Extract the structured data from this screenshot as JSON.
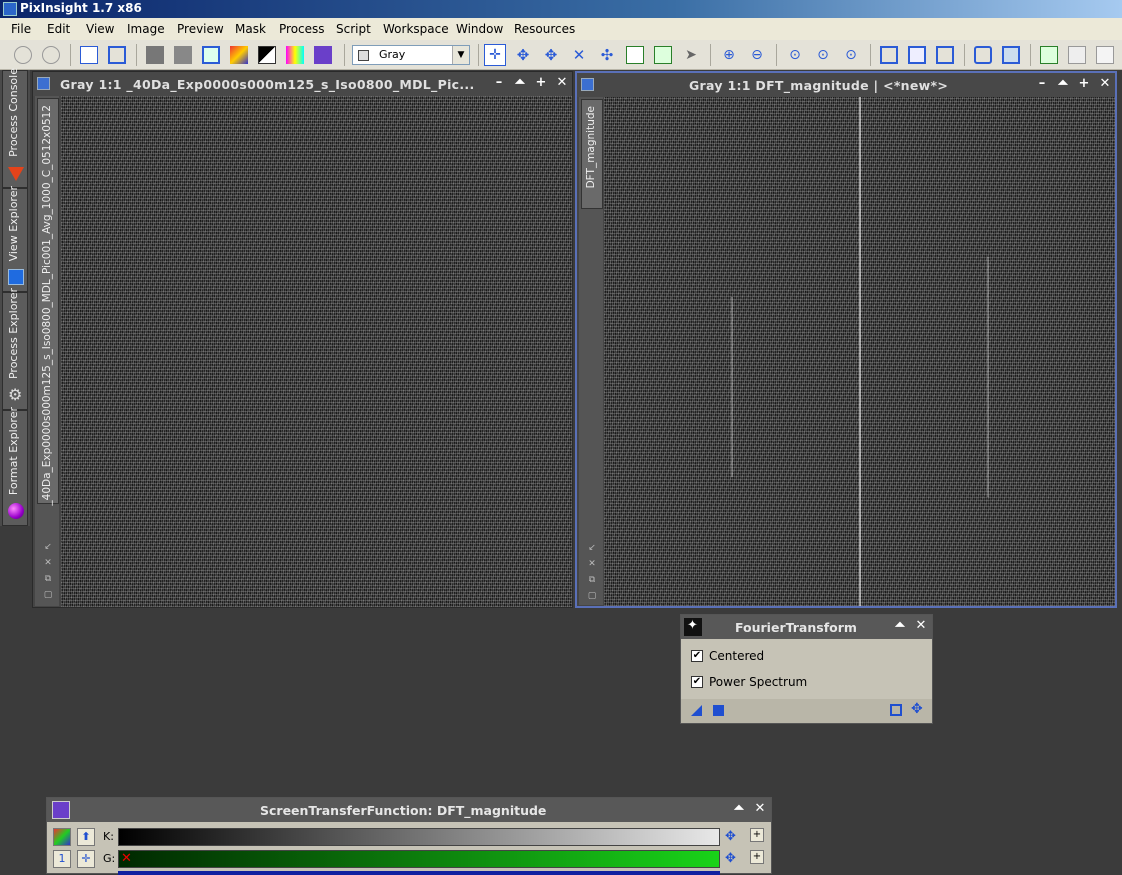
{
  "app": {
    "title": "PixInsight 1.7 x86"
  },
  "menu": [
    "File",
    "Edit",
    "View",
    "Image",
    "Preview",
    "Mask",
    "Process",
    "Script",
    "Workspace",
    "Window",
    "Resources"
  ],
  "toolbar": {
    "view_selector": "Gray"
  },
  "sidebar": {
    "tabs": [
      {
        "label": "Process Console",
        "icon": "console-icon"
      },
      {
        "label": "View Explorer",
        "icon": "view-explorer-icon"
      },
      {
        "label": "Process Explorer",
        "icon": "gear-icon"
      },
      {
        "label": "Format Explorer",
        "icon": "format-explorer-icon"
      }
    ]
  },
  "windows": {
    "left": {
      "title": "Gray 1:1 _40Da_Exp0000s000m125_s_Iso0800_MDL_Pic...",
      "view_tab": "_40Da_Exp0000s000m125_s_Iso0800_MDL_Pic001_Avg_1000_C_0512x0512"
    },
    "right": {
      "title": "Gray 1:1 DFT_magnitude | <*new*>",
      "view_tab": "DFT_magnitude"
    }
  },
  "fourier": {
    "title": "FourierTransform",
    "centered_label": "Centered",
    "centered_checked": true,
    "power_label": "Power Spectrum",
    "power_checked": true
  },
  "stf": {
    "title": "ScreenTransferFunction: DFT_magnitude",
    "channel_k": "K:",
    "channel_g": "G:",
    "colors": {
      "k_start": "#000000",
      "k_end": "#e8e8e8",
      "g_start": "#002800",
      "g_end": "#19d319"
    }
  }
}
